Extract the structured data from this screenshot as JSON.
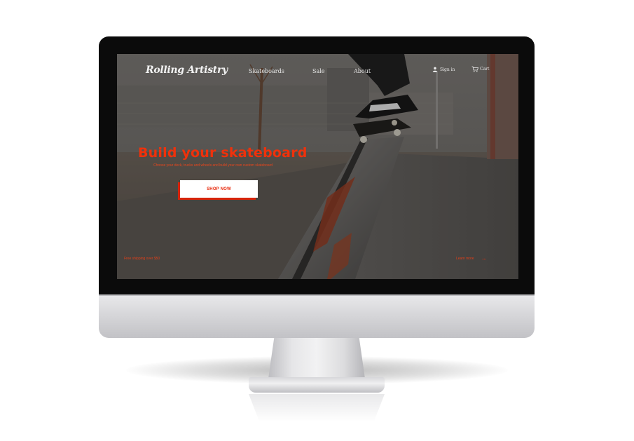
{
  "site": {
    "logo": "Rolling Artistry",
    "nav": [
      "Skateboards",
      "Sale",
      "About"
    ],
    "account": {
      "sign_in": "Sign in",
      "cart": "Cart"
    }
  },
  "hero": {
    "title": "Build your skateboard",
    "subtitle": "Choose your deck, trucks and wheels and build your own custom skateboard",
    "button": "SHOP NOW",
    "footnote_left": "Free shipping over $50",
    "learn_more": "Learn more"
  },
  "colors": {
    "accent": "#f0310b",
    "button_bg": "#ffffff",
    "bezel": "#0b0b0b",
    "chin": "#d3d3d6"
  },
  "icons": [
    "user-icon",
    "cart-icon",
    "arrow-right-icon"
  ]
}
